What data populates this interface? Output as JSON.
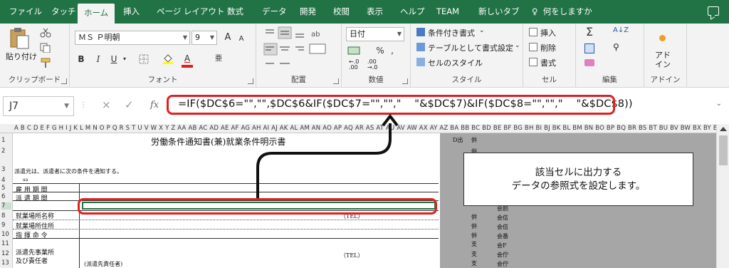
{
  "tabs": [
    "ファイル",
    "タッチ",
    "ホーム",
    "挿入",
    "ページ レイアウト",
    "数式",
    "データ",
    "開発",
    "校閲",
    "表示",
    "ヘルプ",
    "TEAM",
    "新しいタブ"
  ],
  "active_tab": "ホーム",
  "tell_me": "何をしますか",
  "ribbon": {
    "clipboard": {
      "paste": "貼り付け",
      "label": "クリップボード"
    },
    "font": {
      "name": "ＭＳ Ｐ明朝",
      "size": "9",
      "bold": "B",
      "italic": "I",
      "underline": "U",
      "grow": "A",
      "shrink": "A",
      "label": "フォント"
    },
    "alignment": {
      "label": "配置"
    },
    "number": {
      "format": "日付",
      "percent": "%",
      "comma": ",",
      "label": "数値"
    },
    "styles": {
      "conditional": "条件付き書式",
      "table": "テーブルとして書式設定",
      "cell_style": "セルのスタイル",
      "label": "スタイル"
    },
    "cells": {
      "insert": "挿入",
      "delete": "削除",
      "format": "書式",
      "label": "セル"
    },
    "editing": {
      "sum": "Σ",
      "label": "編集"
    },
    "addin": {
      "button": "アド イン",
      "label": "アドイン"
    }
  },
  "formula_bar": {
    "name_box": "J7",
    "cancel": "×",
    "enter": "✓",
    "fx": "fx",
    "formula": "=IF($DC$6=\"\",\"\",$DC$6&IF($DC$7=\"\",\"\",\"    \"&$DC$7)&IF($DC$8=\"\",\"\",\"    \"&$DC$8))"
  },
  "columns": "A B C D E F G H I J K L M N O P Q R S T U V W X Y Z AA AB AC AD AE AF AG AH AI AJ AK AL AM AN AO AP AQ AR AS AT AU AV AW AX AY AZ BA BB BC BD BE BF BG BH BI BJ BK BL BM BN BO BP BQ BR BS BT BU BV BW BX BY BZ CA CB CC CD CE CF CG CH CI CJ",
  "rows": [
    "1",
    "2",
    "3",
    "4",
    "5",
    "6",
    "7",
    "8",
    "9",
    "10",
    "11",
    "12",
    "13"
  ],
  "sheet": {
    "title": "労働条件通知書(兼)就業条件明示書",
    "intro": "派遣元は、派遣者に次の条件を通知する。",
    "small": "aa",
    "labels": [
      "雇 用 期 間",
      "派 遣 期 間",
      "就業場所名称",
      "就業場所住所",
      "指 揮 命 令",
      "派遣先事業所",
      "及び責任者"
    ],
    "tel1": "（TEL）",
    "tel2": "（TEL）",
    "sub": "(派遣先責任者)",
    "side_top": "D出",
    "side_items": [
      "倂",
      "倂",
      "倂",
      "倂",
      "倂",
      "倂",
      "倂",
      "支",
      "支",
      "支"
    ],
    "side_items2": [
      "会創",
      "会佶",
      "会佶",
      "会番",
      "会F",
      "会佇",
      "会佇"
    ]
  },
  "callout": {
    "line1": "該当セルに出力する",
    "line2": "データの参照式を設定します。"
  }
}
